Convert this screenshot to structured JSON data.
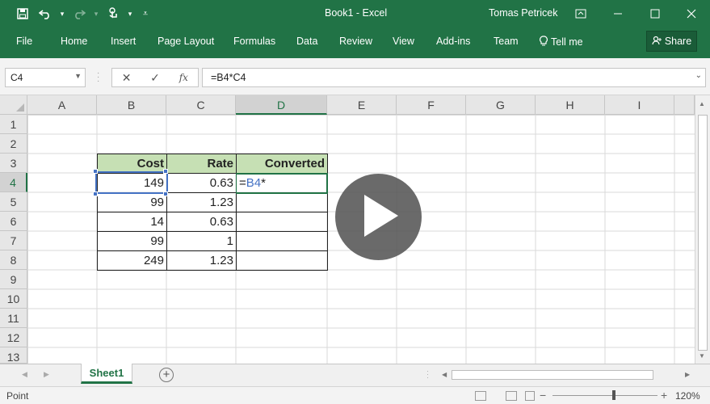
{
  "window": {
    "title": "Book1 - Excel",
    "user": "Tomas Petricek"
  },
  "ribbon": {
    "tabs": [
      "File",
      "Home",
      "Insert",
      "Page Layout",
      "Formulas",
      "Data",
      "Review",
      "View",
      "Add-ins",
      "Team",
      "Tell me"
    ],
    "share_label": "Share"
  },
  "formula_bar": {
    "name_box": "C4",
    "formula": "=B4*C4"
  },
  "grid": {
    "columns": [
      "A",
      "B",
      "C",
      "D",
      "E",
      "F",
      "G",
      "H",
      "I"
    ],
    "rows": [
      "1",
      "2",
      "3",
      "4",
      "5",
      "6",
      "7",
      "8",
      "9",
      "10",
      "11",
      "12",
      "13"
    ],
    "headers": {
      "cost": "Cost",
      "rate": "Rate",
      "converted": "Converted"
    },
    "table_rows": [
      {
        "cost": "149",
        "rate": "0.63"
      },
      {
        "cost": "99",
        "rate": "1.23"
      },
      {
        "cost": "14",
        "rate": "0.63"
      },
      {
        "cost": "99",
        "rate": "1"
      },
      {
        "cost": "249",
        "rate": "1.23"
      }
    ],
    "editing": {
      "prefix": "=",
      "ref": "B4",
      "suffix": "*"
    }
  },
  "sheets": {
    "active": "Sheet1"
  },
  "status": {
    "mode": "Point",
    "zoom": "120%"
  },
  "colors": {
    "accent": "#217346",
    "header_fill": "#c6e0b4",
    "reference_blue": "#4472c4"
  }
}
